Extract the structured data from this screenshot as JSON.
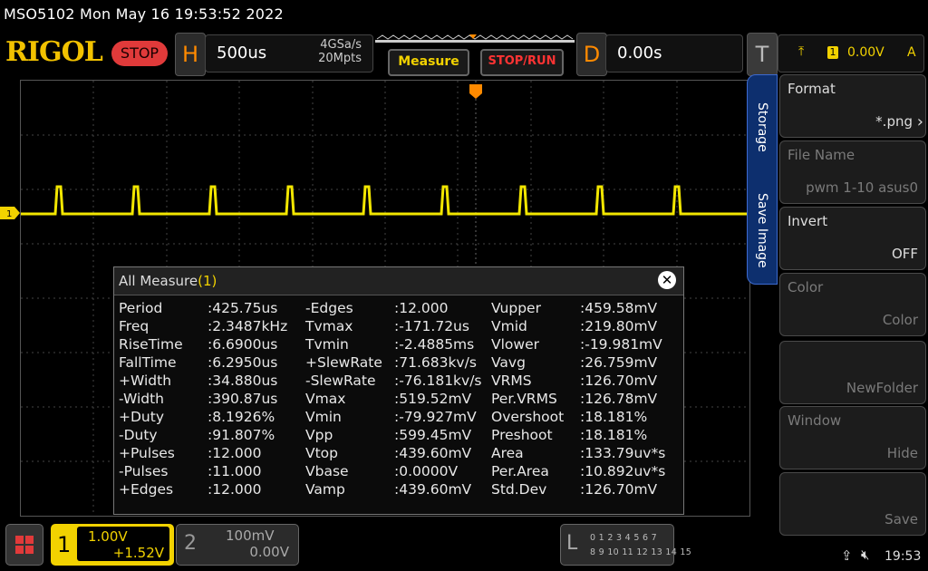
{
  "status": {
    "text": "MSO5102  Mon May 16 19:53:52 2022"
  },
  "toolbar": {
    "logo": "RIGOL",
    "run_state": "STOP",
    "h_letter": "H",
    "timebase": "500us",
    "sample_rate": "4GSa/s",
    "mem_depth": "20Mpts",
    "measure_label": "Measure",
    "stoprun_label": "STOP/RUN",
    "d_letter": "D",
    "delay": "0.00s",
    "t_letter": "T",
    "trigger_source": "1",
    "trigger_level": "0.00V",
    "trigger_mode": "A"
  },
  "measure_panel": {
    "title": "All Measure",
    "count": "(1)",
    "col1": [
      {
        "name": "Period",
        "value": ":425.75us"
      },
      {
        "name": "Freq",
        "value": ":2.3487kHz"
      },
      {
        "name": "RiseTime",
        "value": ":6.6900us"
      },
      {
        "name": "FallTime",
        "value": ":6.2950us"
      },
      {
        "name": "+Width",
        "value": ":34.880us"
      },
      {
        "name": "-Width",
        "value": ":390.87us"
      },
      {
        "name": "+Duty",
        "value": ":8.1926%"
      },
      {
        "name": "-Duty",
        "value": ":91.807%"
      },
      {
        "name": "+Pulses",
        "value": ":12.000"
      },
      {
        "name": "-Pulses",
        "value": ":11.000"
      },
      {
        "name": "+Edges",
        "value": ":12.000"
      }
    ],
    "col2": [
      {
        "name": "-Edges",
        "value": ":12.000"
      },
      {
        "name": "Tvmax",
        "value": ":-171.72us"
      },
      {
        "name": "Tvmin",
        "value": ":-2.4885ms"
      },
      {
        "name": "+SlewRate",
        "value": ":71.683kv/s"
      },
      {
        "name": "-SlewRate",
        "value": ":-76.181kv/s"
      },
      {
        "name": "Vmax",
        "value": ":519.52mV"
      },
      {
        "name": "Vmin",
        "value": ":-79.927mV"
      },
      {
        "name": "Vpp",
        "value": ":599.45mV"
      },
      {
        "name": "Vtop",
        "value": ":439.60mV"
      },
      {
        "name": "Vbase",
        "value": ":0.0000V"
      },
      {
        "name": "Vamp",
        "value": ":439.60mV"
      }
    ],
    "col3": [
      {
        "name": "Vupper",
        "value": ":459.58mV"
      },
      {
        "name": "Vmid",
        "value": ":219.80mV"
      },
      {
        "name": "Vlower",
        "value": ":-19.981mV"
      },
      {
        "name": "Vavg",
        "value": ":26.759mV"
      },
      {
        "name": "VRMS",
        "value": ":126.70mV"
      },
      {
        "name": "Per.VRMS",
        "value": ":126.78mV"
      },
      {
        "name": "Overshoot",
        "value": ":18.181%"
      },
      {
        "name": "Preshoot",
        "value": ":18.181%"
      },
      {
        "name": "Area",
        "value": ":133.79uv*s"
      },
      {
        "name": "Per.Area",
        "value": ":10.892uv*s"
      },
      {
        "name": "Std.Dev",
        "value": ":126.70mV"
      }
    ]
  },
  "side_menu": {
    "tab_storage": "Storage",
    "tab_save_image": "Save Image",
    "items": [
      {
        "label": "Format",
        "value": "*.png"
      },
      {
        "label": "File Name",
        "value": "pwm 1-10 asus0"
      },
      {
        "label": "Invert",
        "value": "OFF"
      },
      {
        "label": "Color",
        "value": "Color"
      },
      {
        "label": "",
        "value": "NewFolder"
      },
      {
        "label": "Window",
        "value": "Hide"
      },
      {
        "label": "",
        "value": "Save"
      }
    ]
  },
  "bottom": {
    "ch1_num": "1",
    "ch1_scale": "1.00V",
    "ch1_offset": "+1.52V",
    "ch2_num": "2",
    "ch2_scale": "100mV",
    "ch2_offset": "0.00V",
    "la_letter": "L",
    "la_row1": "0 1 2 3  4 5 6 7",
    "la_row2": "8 9 10 11 12 13 14 15",
    "time": "19:53"
  },
  "waveform": {
    "ch1_marker": "1",
    "pulse_count": 9,
    "color": "#f2e600"
  }
}
